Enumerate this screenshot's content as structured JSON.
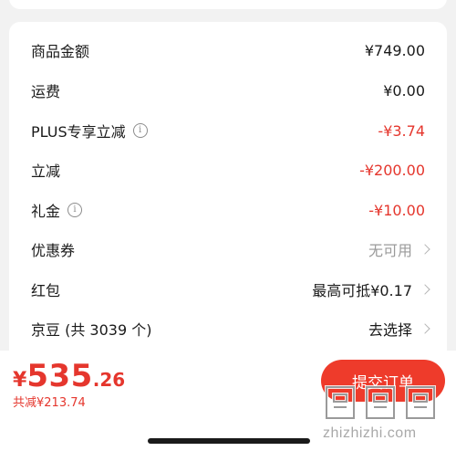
{
  "summary": {
    "rows": [
      {
        "label": "商品金额",
        "value": "¥749.00"
      },
      {
        "label": "运费",
        "value": "¥0.00"
      },
      {
        "label": "PLUS专享立减",
        "value": "-¥3.74"
      },
      {
        "label": "立减",
        "value": "-¥200.00"
      },
      {
        "label": "礼金",
        "value": "-¥10.00"
      },
      {
        "label": "优惠券",
        "value": "无可用"
      },
      {
        "label": "红包",
        "value": "最高可抵¥0.17"
      },
      {
        "label": "京豆 (共 3039 个)",
        "value": "去选择"
      }
    ]
  },
  "bottom": {
    "currency": "¥",
    "total_int": "535",
    "total_dec": ".26",
    "saved": "共减¥213.74",
    "submit_label": "提交订单"
  },
  "watermark": {
    "text": "zhizhizhi.com"
  },
  "colors": {
    "accent": "#e5362d",
    "button": "#ee3b2b",
    "background": "#f2f2f2"
  }
}
